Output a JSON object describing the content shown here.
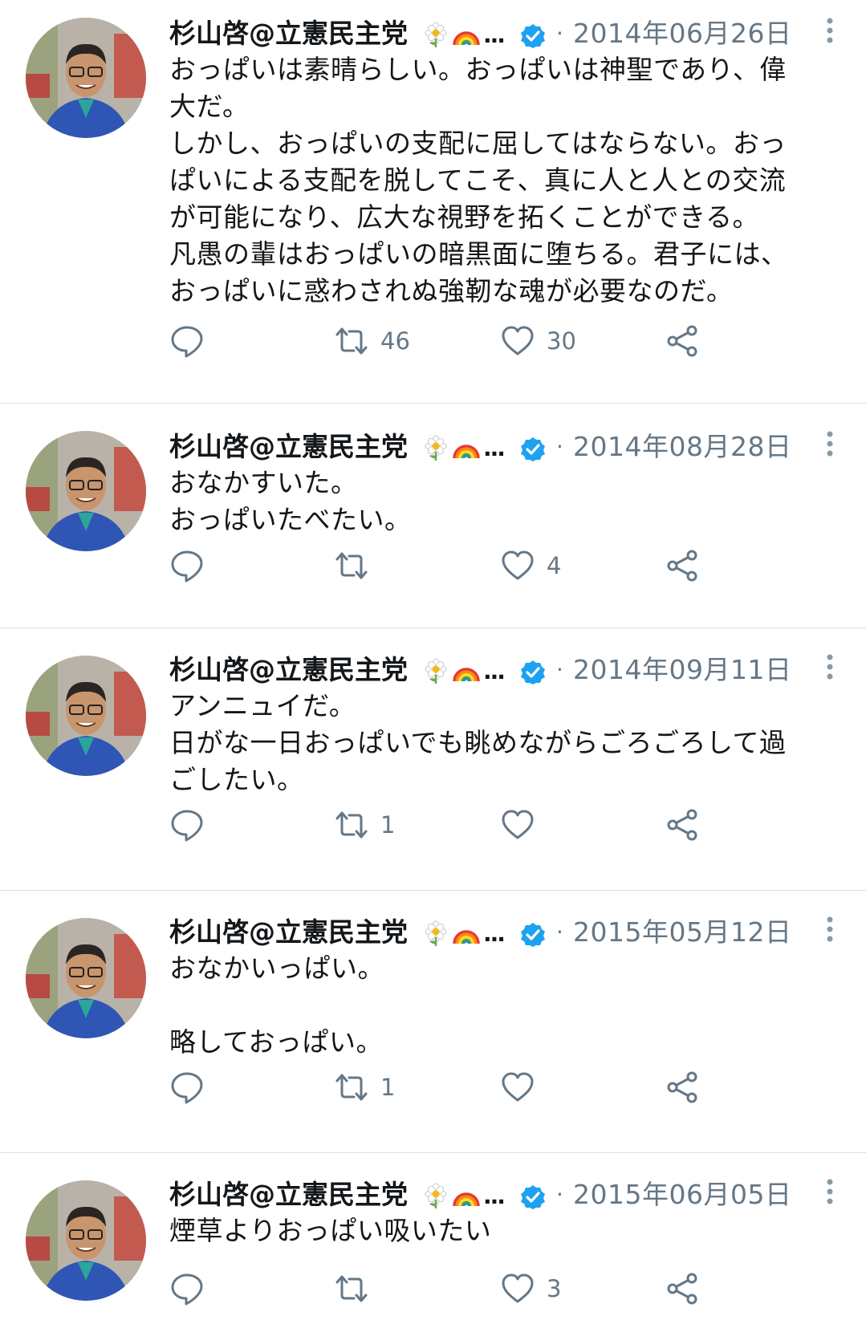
{
  "author": {
    "display_name": "杉山啓@立憲民主党",
    "ellipsis": "...",
    "verified": true,
    "avatar_icon": "person-photo-avatar",
    "emoji_icons": [
      "flower-icon",
      "rainbow-icon"
    ]
  },
  "separator": "·",
  "colors": {
    "text": "#14171a",
    "muted": "#657786",
    "verified": "#1da1f2",
    "divider": "#dcdfe2"
  },
  "tweets": [
    {
      "date": "2014年06月26日",
      "text": "おっぱいは素晴らしい。おっぱいは神聖であり、偉\n大だ。\nしかし、おっぱいの支配に屈してはならない。おっ\nぱいによる支配を脱してこそ、真に人と人との交流\nが可能になり、広大な視野を拓くことができる。\n凡愚の輩はおっぱいの暗黒面に堕ちる。君子には、\nおっぱいに惑わされぬ強靭な魂が必要なのだ。",
      "retweets": "46",
      "likes": "30"
    },
    {
      "date": "2014年08月28日",
      "text": "おなかすいた。\nおっぱいたべたい。",
      "retweets": "",
      "likes": "4"
    },
    {
      "date": "2014年09月11日",
      "text": "アンニュイだ。\n日がな一日おっぱいでも眺めながらごろごろして過\nごしたい。",
      "retweets": "1",
      "likes": ""
    },
    {
      "date": "2015年05月12日",
      "text": "おなかいっぱい。\n\n略しておっぱい。",
      "retweets": "1",
      "likes": ""
    },
    {
      "date": "2015年06月05日",
      "text": "煙草よりおっぱい吸いたい",
      "retweets": "",
      "likes": "3"
    }
  ]
}
